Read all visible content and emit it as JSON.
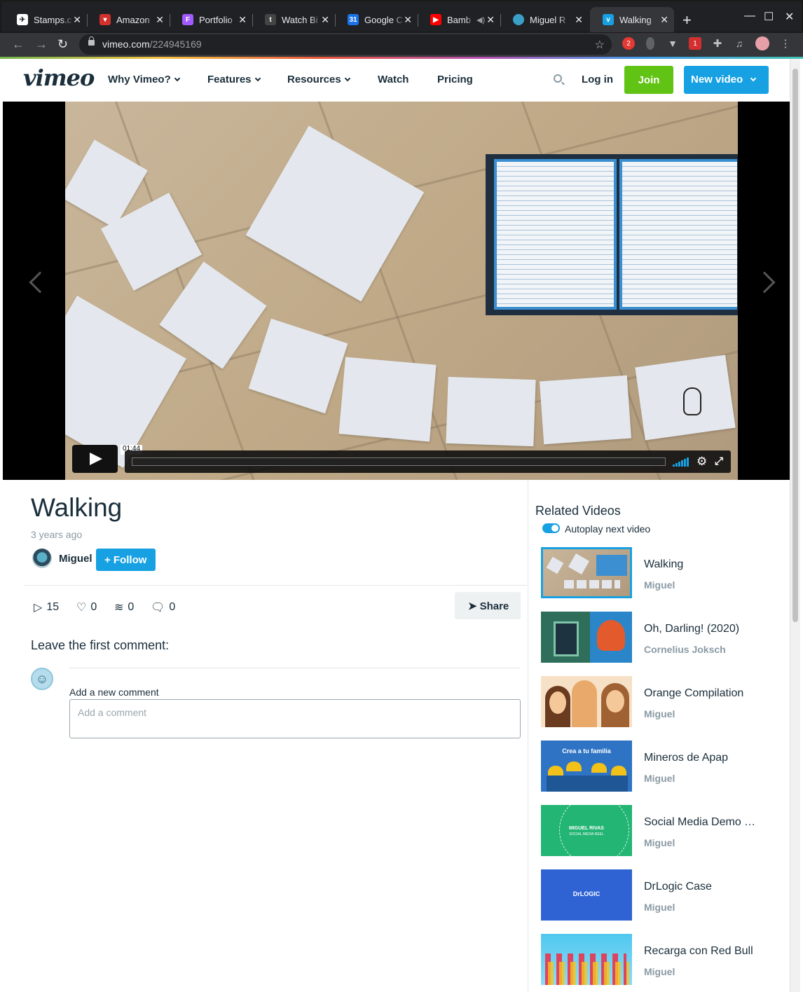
{
  "browser": {
    "tabs": [
      {
        "title": "Stamps.c",
        "favicon_color": "#ffffff",
        "favicon": "stamps-icon",
        "active": false
      },
      {
        "title": "Amazon",
        "favicon_color": "#d0312d",
        "favicon": "amazon-bird-icon",
        "active": false
      },
      {
        "title": "Portfolio",
        "favicon_color": "#a259ff",
        "favicon": "figma-icon",
        "active": false
      },
      {
        "title": "Watch Bi",
        "favicon_color": "#444444",
        "favicon": "tumblr-icon",
        "active": false
      },
      {
        "title": "Google C",
        "favicon_color": "#1a73e8",
        "favicon": "google-calendar-icon",
        "active": false
      },
      {
        "title": "Bamb",
        "favicon_color": "#ff0000",
        "favicon": "youtube-icon",
        "active": false,
        "audio": true
      },
      {
        "title": "Miguel R",
        "favicon_color": "#3aa0c8",
        "favicon": "globe-avatar-icon",
        "active": false
      },
      {
        "title": "Walking",
        "favicon_color": "#17a1e3",
        "favicon": "vimeo-icon",
        "active": true
      }
    ],
    "url_host": "vimeo.com",
    "url_path": "/224945169",
    "ext_badges": [
      "2",
      "1"
    ]
  },
  "nav": {
    "logo": "vimeo",
    "links": [
      "Why Vimeo?",
      "Features",
      "Resources",
      "Watch",
      "Pricing"
    ],
    "login": "Log in",
    "join": "Join",
    "new_video": "New video"
  },
  "player": {
    "time_tooltip": "01:44",
    "progress": 0
  },
  "video": {
    "title": "Walking",
    "age": "3 years ago",
    "author": "Miguel",
    "follow_label": "+ Follow",
    "stats": {
      "plays": "15",
      "likes": "0",
      "collections": "0",
      "comments": "0"
    },
    "share_label": "Share"
  },
  "comments": {
    "heading": "Leave the first comment:",
    "add_label": "Add a new comment",
    "placeholder": "Add a comment"
  },
  "related": {
    "heading": "Related Videos",
    "autoplay_label": "Autoplay next video",
    "autoplay_on": true,
    "items": [
      {
        "title": "Walking",
        "author": "Miguel"
      },
      {
        "title": "Oh, Darling! (2020)",
        "author": "Cornelius Joksch"
      },
      {
        "title": "Orange Compilation",
        "author": "Miguel"
      },
      {
        "title": "Mineros de Apap",
        "author": "Miguel"
      },
      {
        "title": "Social Media Demo Reel",
        "author": "Miguel"
      },
      {
        "title": "DrLogic Case",
        "author": "Miguel"
      },
      {
        "title": "Recarga con Red Bull",
        "author": "Miguel"
      }
    ],
    "thumb_text": {
      "mineros": "Crea a tu familia",
      "social_line1": "MIGUEL RIVAS",
      "social_line2": "SOCIAL MEDIA REEL",
      "drlogic": "DrLOGIC"
    }
  }
}
